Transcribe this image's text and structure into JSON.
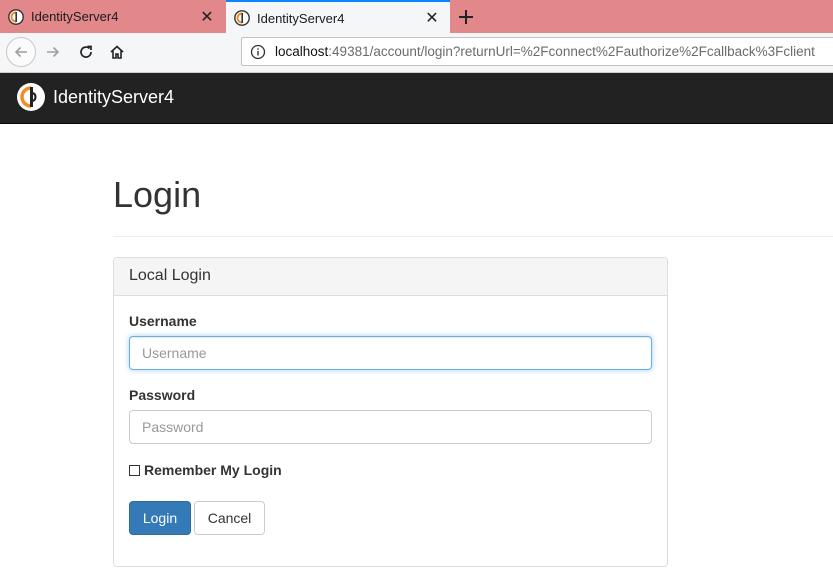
{
  "browser": {
    "tabs": [
      {
        "title": "IdentityServer4",
        "active": false
      },
      {
        "title": "IdentityServer4",
        "active": true
      }
    ],
    "new_tab_icon": "plus-icon",
    "address_bar": {
      "host": "localhost",
      "rest": ":49381/account/login?returnUrl=%2Fconnect%2Fauthorize%2Fcallback%3Fclient"
    }
  },
  "site": {
    "brand": "IdentityServer4",
    "header_bg": "#222222"
  },
  "page": {
    "title": "Login"
  },
  "panel": {
    "heading": "Local Login",
    "username_label": "Username",
    "username_placeholder": "Username",
    "username_value": "",
    "password_label": "Password",
    "password_placeholder": "Password",
    "password_value": "",
    "remember_label": "Remember My Login",
    "remember_checked": false,
    "login_button": "Login",
    "cancel_button": "Cancel"
  },
  "colors": {
    "tabbar": "#e2878a",
    "accent": "#0a84ff",
    "primary_button": "#337ab7"
  }
}
